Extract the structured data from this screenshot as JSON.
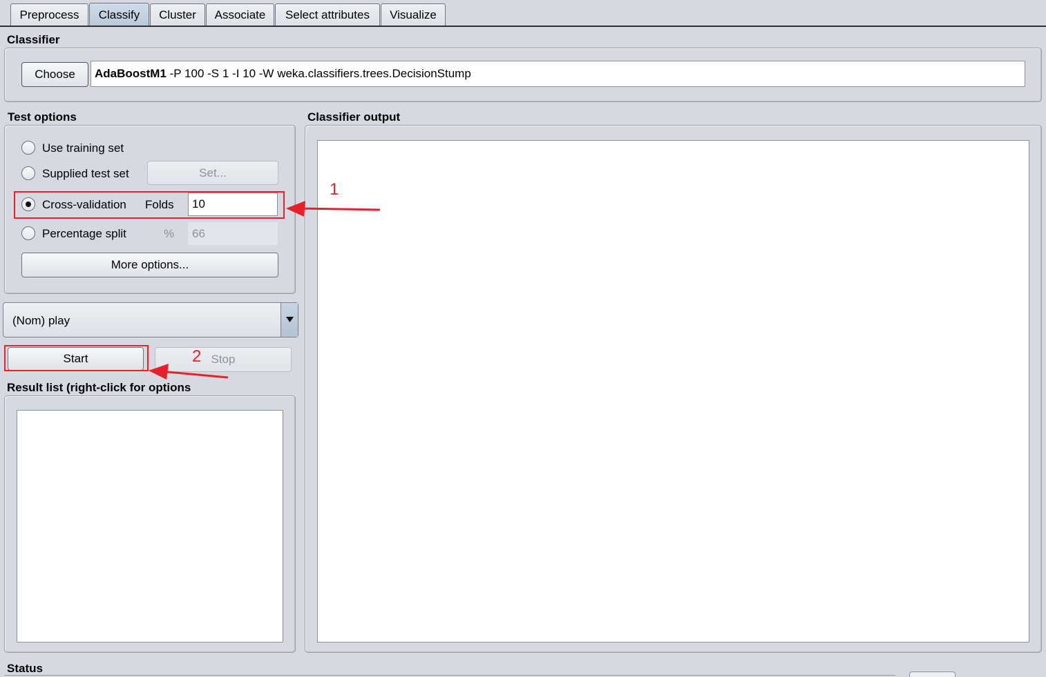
{
  "tabs": [
    "Preprocess",
    "Classify",
    "Cluster",
    "Associate",
    "Select attributes",
    "Visualize"
  ],
  "active_tab": "Classify",
  "classifier": {
    "section_title": "Classifier",
    "choose_label": "Choose",
    "name": "AdaBoostM1",
    "options": " -P 100 -S 1 -I 10 -W weka.classifiers.trees.DecisionStump"
  },
  "test_options": {
    "title": "Test options",
    "use_training": "Use training set",
    "supplied": "Supplied test set",
    "set_button": "Set...",
    "cross_validation": "Cross-validation",
    "folds_label": "Folds",
    "folds_value": "10",
    "percentage_split": "Percentage split",
    "percent_symbol": "%",
    "percent_value": "66",
    "more_options": "More options...",
    "selected": "Cross-validation"
  },
  "class_attribute": "(Nom) play",
  "buttons": {
    "start": "Start",
    "stop": "Stop"
  },
  "result_list_title": "Result list (right-click for options",
  "output_title": "Classifier output",
  "status_title": "Status",
  "annotations": {
    "first": "1",
    "second": "2"
  },
  "colors": {
    "annotation": "#e8202a",
    "active_tab": "#c3d0de",
    "panel": "#d6d9df"
  }
}
